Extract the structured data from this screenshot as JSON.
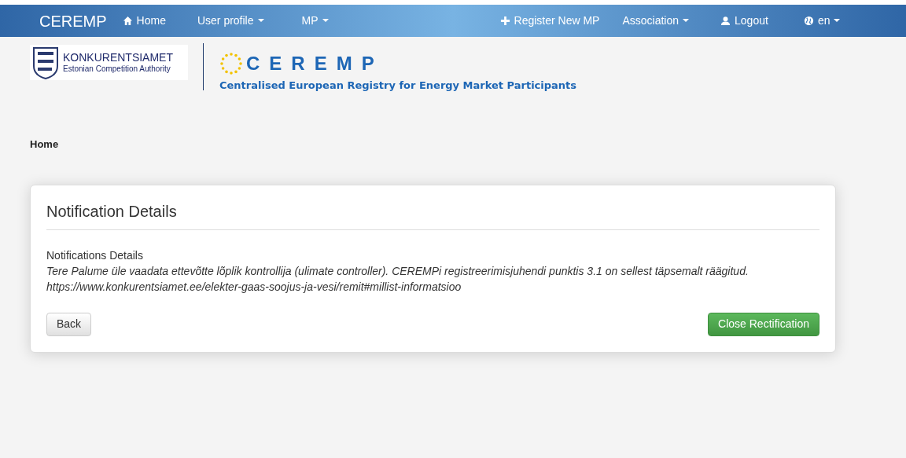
{
  "navbar": {
    "brand": "CEREMP",
    "left_items": [
      {
        "label": "Home",
        "dropdown": false
      },
      {
        "label": "User profile",
        "dropdown": true
      },
      {
        "label": "MP",
        "dropdown": true
      }
    ],
    "right_items": [
      {
        "label": "Register New MP",
        "dropdown": false
      },
      {
        "label": "Association",
        "dropdown": true
      },
      {
        "label": "Logout",
        "dropdown": false
      },
      {
        "label": "en",
        "dropdown": true
      }
    ]
  },
  "header": {
    "authority": {
      "name": "KONKURENTSIAMET",
      "subtitle": "Estonian Competition Authority"
    },
    "registry": {
      "name": "CEREMP",
      "subtitle": "Centralised European Registry for Energy Market Participants"
    }
  },
  "breadcrumb": "Home",
  "panel": {
    "title": "Notification Details",
    "section_label": "Notifications Details",
    "message_lines": [
      "Tere Palume üle vaadata ettevõtte lõplik kontrollija (ulimate controller). CEREMPi registreerimisjuhendi punktis 3.1 on sellest täpsemalt räägitud.",
      "https://www.konkurentsiamet.ee/elekter-gaas-soojus-ja-vesi/remit#millist-informatsioo"
    ],
    "buttons": [
      {
        "label": "Back",
        "kind": "default"
      },
      {
        "label": "Close Rectification",
        "kind": "success"
      }
    ]
  }
}
